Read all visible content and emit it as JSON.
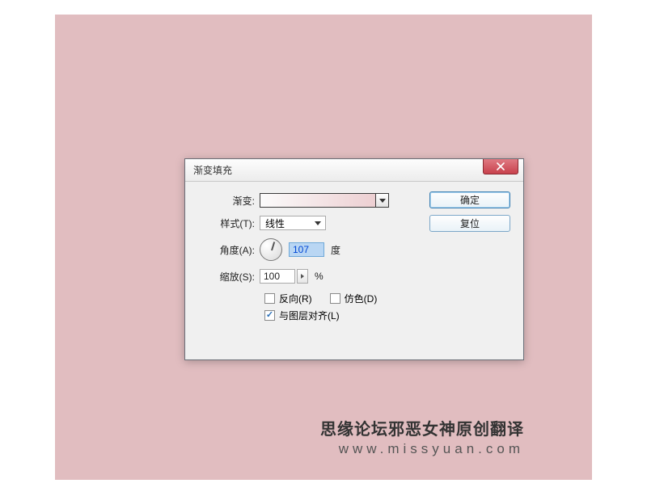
{
  "dialog": {
    "title": "渐变填充",
    "buttons": {
      "ok": "确定",
      "reset": "复位"
    },
    "gradient_label": "渐变:",
    "style": {
      "label": "样式(T):",
      "value": "线性"
    },
    "angle": {
      "label": "角度(A):",
      "value": "107",
      "unit": "度"
    },
    "scale": {
      "label": "缩放(S):",
      "value": "100",
      "unit": "%"
    },
    "checks": {
      "reverse": {
        "label": "反向(R)",
        "checked": false
      },
      "dither": {
        "label": "仿色(D)",
        "checked": false
      },
      "align": {
        "label": "与图层对齐(L)",
        "checked": true
      }
    }
  },
  "watermark": {
    "line1": "思缘论坛邪恶女神原创翻译",
    "line2": "www.missyuan.com"
  }
}
